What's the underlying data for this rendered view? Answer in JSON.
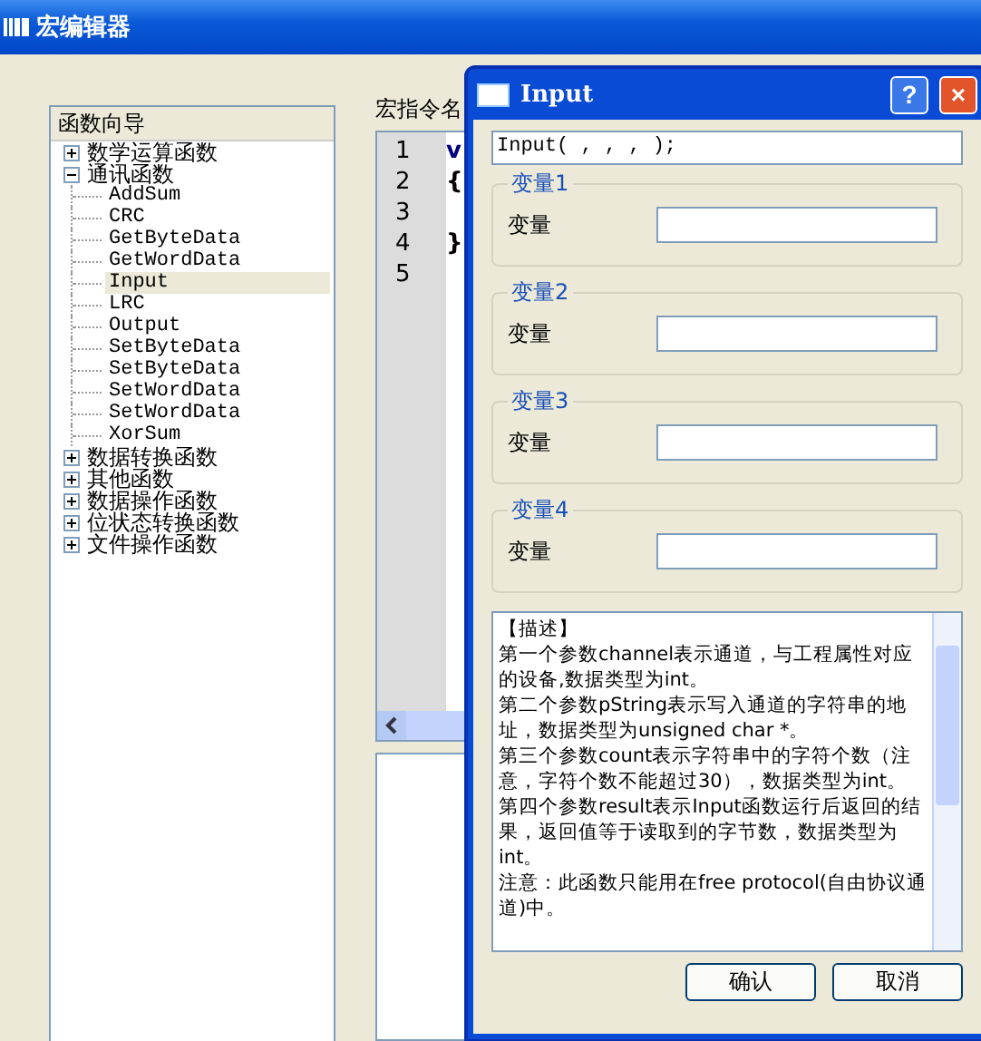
{
  "window": {
    "title": "宏编辑器"
  },
  "tree": {
    "header": "函数向导",
    "items": [
      {
        "label": "数学运算函数",
        "expanded": false
      },
      {
        "label": "通讯函数",
        "expanded": true,
        "children": [
          {
            "label": "AddSum",
            "selected": false
          },
          {
            "label": "CRC",
            "selected": false
          },
          {
            "label": "GetByteData",
            "selected": false
          },
          {
            "label": "GetWordData",
            "selected": false
          },
          {
            "label": "Input",
            "selected": true
          },
          {
            "label": "LRC",
            "selected": false
          },
          {
            "label": "Output",
            "selected": false
          },
          {
            "label": "SetByteData",
            "selected": false
          },
          {
            "label": "SetByteData",
            "selected": false
          },
          {
            "label": "SetWordData",
            "selected": false
          },
          {
            "label": "SetWordData",
            "selected": false
          },
          {
            "label": "XorSum",
            "selected": false
          }
        ]
      },
      {
        "label": "数据转换函数",
        "expanded": false
      },
      {
        "label": "其他函数",
        "expanded": false
      },
      {
        "label": "数据操作函数",
        "expanded": false
      },
      {
        "label": "位状态转换函数",
        "expanded": false
      },
      {
        "label": "文件操作函数",
        "expanded": false
      }
    ]
  },
  "editor": {
    "name_label": "宏指令名",
    "lines": [
      {
        "number": "1",
        "text": "v"
      },
      {
        "number": "2",
        "text": "{"
      },
      {
        "number": "3"
      },
      {
        "number": "4",
        "text": "}"
      },
      {
        "number": "5"
      }
    ]
  },
  "dialog": {
    "title": "Input",
    "help": "?",
    "close": "×",
    "expression": "Input( , , , );",
    "groups": [
      {
        "title": "变量1",
        "label": "变量"
      },
      {
        "title": "变量2",
        "label": "变量"
      },
      {
        "title": "变量3",
        "label": "变量"
      },
      {
        "title": "变量4",
        "label": "变量"
      }
    ],
    "description": [
      "【描述】",
      "第一个参数channel表示通道，与工程属性对应的设备,数据类型为int。",
      "第二个参数pString表示写入通道的字符串的地址，数据类型为unsigned char *。",
      "第三个参数count表示字符串中的字符个数（注意，字符个数不能超过30），数据类型为int。",
      "第四个参数result表示Input函数运行后返回的结果，返回值等于读取到的字节数，数据类型为int。",
      "注意：此函数只能用在free protocol(自由协议通道)中。"
    ],
    "buttons": [
      "确认",
      "取消"
    ]
  }
}
